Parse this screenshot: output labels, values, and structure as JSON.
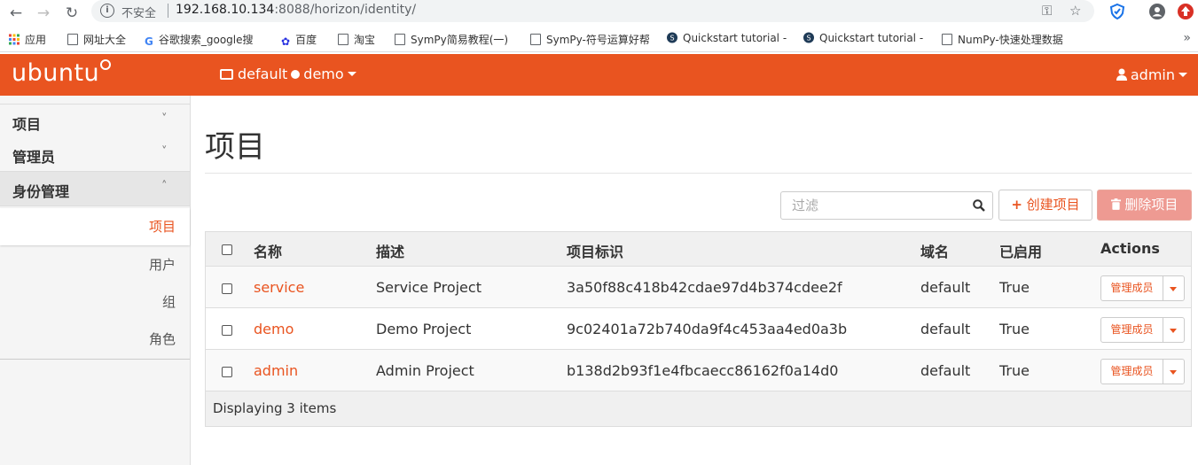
{
  "browser": {
    "security_label": "不安全",
    "url_host": "192.168.10.134",
    "url_rest": ":8088/horizon/identity/",
    "bookmarks": [
      {
        "label": "应用"
      },
      {
        "label": "网址大全"
      },
      {
        "label": "谷歌搜索_google搜"
      },
      {
        "label": "百度"
      },
      {
        "label": "淘宝"
      },
      {
        "label": "SymPy简易教程(一)"
      },
      {
        "label": "SymPy-符号运算好帮"
      },
      {
        "label": "Quickstart tutorial -"
      },
      {
        "label": "Quickstart tutorial -"
      },
      {
        "label": "NumPy-快速处理数据"
      }
    ],
    "bookmarks_more": "»"
  },
  "header": {
    "logo_text": "ubuntu",
    "domain": "default",
    "project": "demo",
    "user": "admin",
    "brand_color": "#e95420"
  },
  "sidebar": {
    "sections": [
      {
        "label": "项目",
        "chevron": "˅"
      },
      {
        "label": "管理员",
        "chevron": "˅"
      },
      {
        "label": "身份管理",
        "chevron": "˄"
      }
    ],
    "items": [
      {
        "label": "项目"
      },
      {
        "label": "用户"
      },
      {
        "label": "组"
      },
      {
        "label": "角色"
      }
    ]
  },
  "main": {
    "title": "项目",
    "filter_placeholder": "过滤",
    "create_label": "创建项目",
    "delete_label": "删除项目",
    "table": {
      "headers": {
        "name": "名称",
        "description": "描述",
        "project_id": "项目标识",
        "domain": "域名",
        "enabled": "已启用",
        "actions": "Actions"
      },
      "rows": [
        {
          "name": "service",
          "description": "Service Project",
          "project_id": "3a50f88c418b42cdae97d4b374cdee2f",
          "domain": "default",
          "enabled": "True",
          "action": "管理成员"
        },
        {
          "name": "demo",
          "description": "Demo Project",
          "project_id": "9c02401a72b740da9f4c453aa4ed0a3b",
          "domain": "default",
          "enabled": "True",
          "action": "管理成员"
        },
        {
          "name": "admin",
          "description": "Admin Project",
          "project_id": "b138d2b93f1e4fbcaecc86162f0a14d0",
          "domain": "default",
          "enabled": "True",
          "action": "管理成员"
        }
      ],
      "footer": "Displaying 3 items"
    }
  }
}
